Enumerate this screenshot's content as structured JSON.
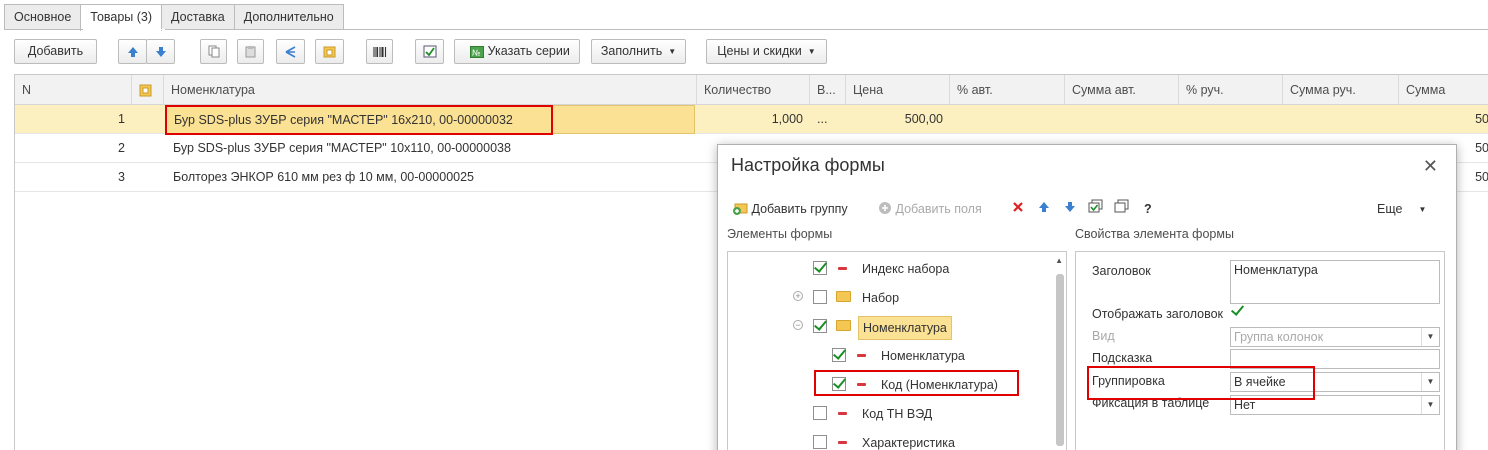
{
  "tabs": [
    "Основное",
    "Товары (3)",
    "Доставка",
    "Дополнительно"
  ],
  "toolbar": {
    "add": "Добавить",
    "series": "Указать серии",
    "fill": "Заполнить",
    "prices": "Цены и скидки"
  },
  "grid": {
    "columns": [
      "N",
      "",
      "Номенклатура",
      "Количество",
      "В...",
      "Цена",
      "% авт.",
      "Сумма авт.",
      "% руч.",
      "Сумма руч.",
      "Сумма"
    ],
    "rows": [
      {
        "n": "1",
        "name": "Бур SDS-plus ЗУБР серия \"МАСТЕР\" 16x210, 00-00000032",
        "qty": "1,000",
        "unit": "...",
        "price": "500,00",
        "sum": "50"
      },
      {
        "n": "2",
        "name": "Бур SDS-plus ЗУБР серия \"МАСТЕР\" 10x110, 00-00000038",
        "sum": "50"
      },
      {
        "n": "3",
        "name": "Болторез ЭНКОР 610 мм рез ф 10 мм, 00-00000025",
        "sum": "50"
      }
    ]
  },
  "dialog": {
    "title": "Настройка формы",
    "add_group": "Добавить группу",
    "add_fields": "Добавить поля",
    "help": "?",
    "more": "Еще",
    "elements_label": "Элементы формы",
    "props_label": "Свойства элемента формы",
    "tree": [
      {
        "label": "Индекс набора",
        "checked": true
      },
      {
        "label": "Набор",
        "checked": false
      },
      {
        "label": "Номенклатура",
        "checked": true
      },
      {
        "label": "Номенклатура",
        "checked": true
      },
      {
        "label": "Код (Номенклатура)",
        "checked": true
      },
      {
        "label": "Код ТН ВЭД",
        "checked": false
      },
      {
        "label": "Характеристика",
        "checked": false
      }
    ],
    "props": {
      "caption_label": "Заголовок",
      "caption_value": "Номенклатура",
      "show_caption_label": "Отображать заголовок",
      "view_label": "Вид",
      "view_value": "Группа колонок",
      "hint_label": "Подсказка",
      "hint_value": "",
      "grouping_label": "Группировка",
      "grouping_value": "В ячейке",
      "fix_label": "Фиксация в таблице",
      "fix_value": "Нет"
    }
  },
  "colors": {
    "accent_red": "#e00000",
    "selection": "#fcf0c0",
    "highlight": "#fbe193",
    "check_green": "#1b8f27"
  }
}
